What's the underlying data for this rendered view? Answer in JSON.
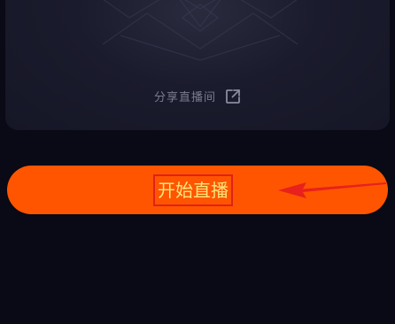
{
  "preview": {
    "share_label": "分享直播间",
    "share_icon": "external-share-icon"
  },
  "primary_action": {
    "label": "开始直播",
    "color": "#ff5500",
    "label_color": "#ffe67a",
    "highlight_box_color": "#e0201a"
  },
  "annotation": {
    "arrow_color": "#e8211c"
  }
}
